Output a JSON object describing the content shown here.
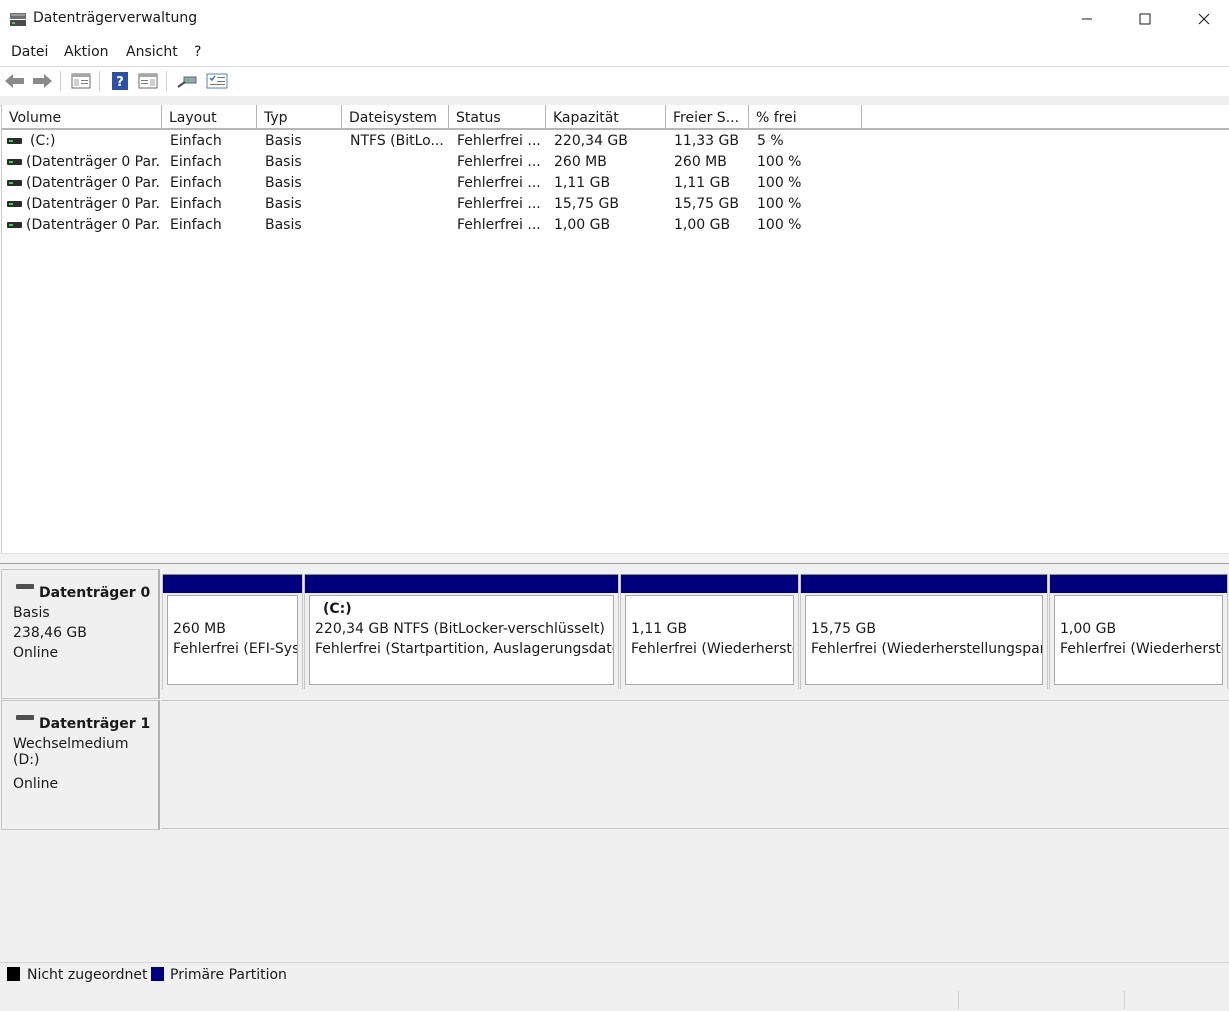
{
  "window": {
    "title": "Datenträgerverwaltung",
    "controls": {
      "minimize": "—",
      "maximize": "☐",
      "close": "✕"
    }
  },
  "menu": [
    "Datei",
    "Aktion",
    "Ansicht",
    "?"
  ],
  "toolbar": [
    "back-icon",
    "forward-icon",
    "console-tree-icon",
    "help-icon",
    "show-pane-icon",
    "connect-icon",
    "properties-icon"
  ],
  "list": {
    "columns": [
      "Volume",
      "Layout",
      "Typ",
      "Dateisystem",
      "Status",
      "Kapazität",
      "Freier S...",
      "% frei"
    ],
    "rows": [
      [
        "(C:)",
        "Einfach",
        "Basis",
        "NTFS (BitLo...",
        "Fehlerfrei ...",
        "220,34 GB",
        "11,33 GB",
        "5 %"
      ],
      [
        "(Datenträger 0 Par...",
        "Einfach",
        "Basis",
        "",
        "Fehlerfrei ...",
        "260 MB",
        "260 MB",
        "100 %"
      ],
      [
        "(Datenträger 0 Par...",
        "Einfach",
        "Basis",
        "",
        "Fehlerfrei ...",
        "1,11 GB",
        "1,11 GB",
        "100 %"
      ],
      [
        "(Datenträger 0 Par...",
        "Einfach",
        "Basis",
        "",
        "Fehlerfrei ...",
        "15,75 GB",
        "15,75 GB",
        "100 %"
      ],
      [
        "(Datenträger 0 Par...",
        "Einfach",
        "Basis",
        "",
        "Fehlerfrei ...",
        "1,00 GB",
        "1,00 GB",
        "100 %"
      ]
    ]
  },
  "disks": [
    {
      "name": "Datenträger 0",
      "type": "Basis",
      "size": "238,46 GB",
      "state": "Online",
      "partitions": [
        {
          "name": "",
          "size": "260 MB",
          "status": "Fehlerfrei (EFI-Syst"
        },
        {
          "name": "(C:)",
          "size": "220,34 GB NTFS (BitLocker-verschlüsselt)",
          "status": "Fehlerfrei (Startpartition, Auslagerungsdatei,"
        },
        {
          "name": "",
          "size": "1,11 GB",
          "status": "Fehlerfrei (Wiederherste"
        },
        {
          "name": "",
          "size": "15,75 GB",
          "status": "Fehlerfrei (Wiederherstellungsparti"
        },
        {
          "name": "",
          "size": "1,00 GB",
          "status": "Fehlerfrei (Wiederherste"
        }
      ]
    },
    {
      "name": "Datenträger 1",
      "type": "Wechselmedium (D:)",
      "state": "Online"
    }
  ],
  "legend": [
    {
      "label": "Nicht zugeordnet",
      "color": "#000000"
    },
    {
      "label": "Primäre Partition",
      "color": "#00007e"
    }
  ],
  "colors": {
    "partition_header": "#00007e",
    "background": "#f0f0f0"
  }
}
